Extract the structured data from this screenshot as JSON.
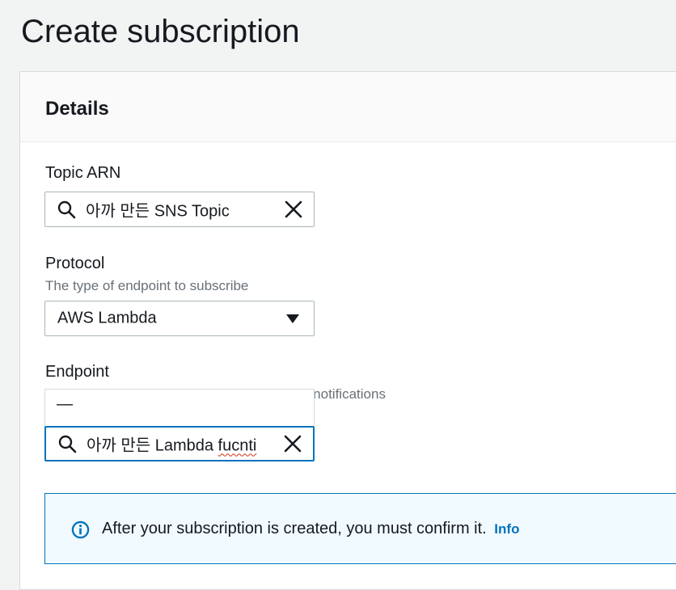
{
  "page": {
    "title": "Create subscription"
  },
  "details": {
    "title": "Details",
    "topic_arn": {
      "label": "Topic ARN",
      "value": "아까 만든 SNS Topic"
    },
    "protocol": {
      "label": "Protocol",
      "description": "The type of endpoint to subscribe",
      "value": "AWS Lambda"
    },
    "endpoint": {
      "label": "Endpoint",
      "description_visible_tail": "e notifications",
      "dropdown_option": "—",
      "value_prefix": "아까 만든 Lambda ",
      "value_misspelled": "fucnti"
    }
  },
  "alert": {
    "message": "After your subscription is created, you must confirm it.",
    "link": "Info"
  },
  "colors": {
    "accent": "#0073bb",
    "alert_bg": "#f1faff",
    "page_bg": "#f2f3f3"
  }
}
